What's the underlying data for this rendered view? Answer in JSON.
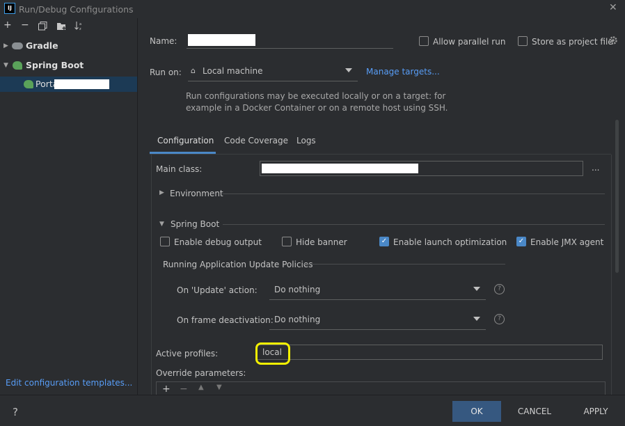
{
  "window": {
    "title": "Run/Debug Configurations",
    "logo": "IJ"
  },
  "toolbar": {
    "add": "+",
    "remove": "−",
    "copy": "copy-icon",
    "folder": "folder-add-icon",
    "sort": "sort-icon"
  },
  "tree": {
    "gradle": "Gradle",
    "spring_boot": "Spring Boot",
    "portal": "Porta"
  },
  "left_footer": {
    "edit_templates": "Edit configuration templates..."
  },
  "form": {
    "name_label": "Name:",
    "allow_parallel": "Allow parallel run",
    "store_project": "Store as project file",
    "run_on_label": "Run on:",
    "run_on_value": "Local machine",
    "manage_targets": "Manage targets...",
    "help_line1": "Run configurations may be executed locally or on a target: for",
    "help_line2": "example in a Docker Container or on a remote host using SSH."
  },
  "tabs": [
    "Configuration",
    "Code Coverage",
    "Logs"
  ],
  "config": {
    "main_class_label": "Main class:",
    "browse": "...",
    "environment": "Environment",
    "spring_boot": "Spring Boot",
    "enable_debug": "Enable debug output",
    "hide_banner": "Hide banner",
    "enable_launch": "Enable launch optimization",
    "enable_jmx": "Enable JMX agent",
    "policies_title": "Running Application Update Policies",
    "on_update_label": "On 'Update' action:",
    "on_update_value": "Do nothing",
    "on_frame_label": "On frame deactivation:",
    "on_frame_value": "Do nothing",
    "active_profiles_label": "Active profiles:",
    "active_profiles_value": "local",
    "override_label": "Override parameters:"
  },
  "checkbox_states": {
    "allow_parallel": false,
    "store_project": false,
    "enable_debug": false,
    "hide_banner": false,
    "enable_launch": true,
    "enable_jmx": true
  },
  "footer": {
    "help": "?",
    "ok": "OK",
    "cancel": "CANCEL",
    "apply": "APPLY"
  },
  "colors": {
    "accent": "#4a88c7",
    "link": "#589df6",
    "highlight": "#f3f000"
  }
}
